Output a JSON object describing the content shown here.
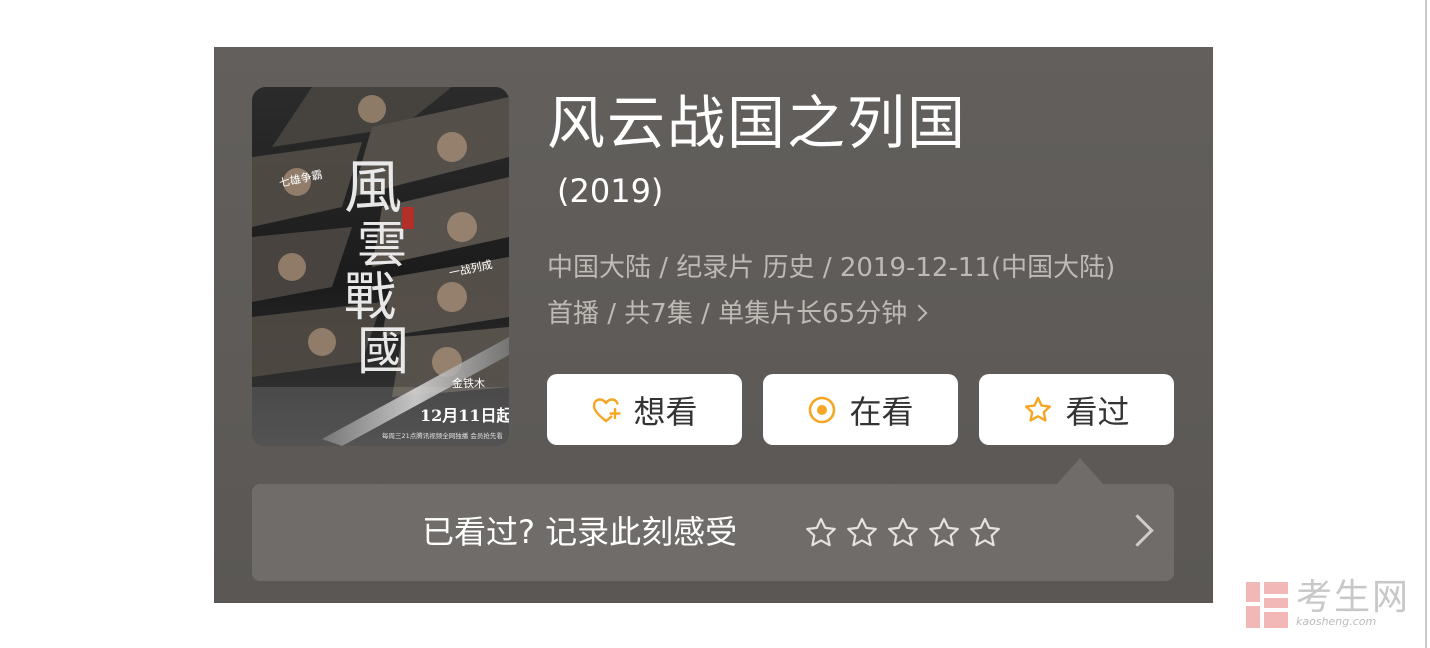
{
  "movie": {
    "title": "风云战国之列国",
    "year": "(2019)",
    "meta_line1": "中国大陆 / 纪录片 历史 / 2019-12-11(中国大陆)",
    "meta_line2": "首播 / 共7集 / 单集片长65分钟"
  },
  "poster": {
    "release_text": "12月11日起",
    "side_text_left": "七雄争霸",
    "side_text_right": "一战列成",
    "name_text": "金铁木",
    "bottom_small": "每周三21点腾讯视频全网独播 会员抢先看"
  },
  "actions": {
    "want_label": "想看",
    "watching_label": "在看",
    "watched_label": "看过"
  },
  "rating": {
    "prompt": "已看过? 记录此刻感受",
    "max_stars": 5,
    "current_stars": 0
  },
  "watermark": {
    "text": "考生网",
    "url": "kaosheng.com"
  },
  "colors": {
    "accent": "#f5a623",
    "card_bg": "#5d5a57",
    "rate_bar_bg": "#6f6c69"
  },
  "icons": {
    "want": "heart-plus-icon",
    "watching": "target-circle-icon",
    "watched": "star-outline-icon",
    "rate_star": "star-outline-icon",
    "rate_more": "chevron-right-icon"
  }
}
